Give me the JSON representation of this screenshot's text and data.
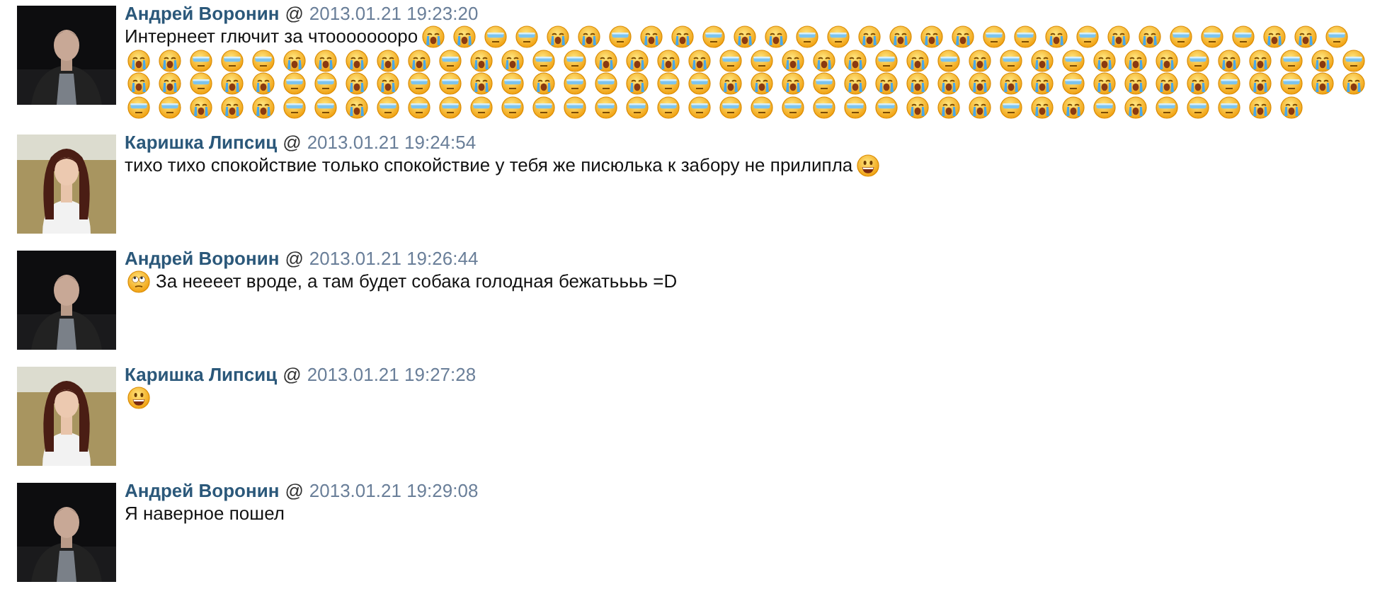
{
  "messages": [
    {
      "author": "Андрей Воронин",
      "at": "@",
      "timestamp": "2013.01.21 19:23:20",
      "avatar": {
        "kind": "night"
      },
      "parts": [
        {
          "kind": "text",
          "text": "Интернеет глючит за чтоооооооро"
        },
        {
          "kind": "sob"
        },
        {
          "kind": "sob"
        },
        {
          "kind": "shades"
        },
        {
          "kind": "shades"
        },
        {
          "kind": "sob"
        },
        {
          "kind": "sob"
        },
        {
          "kind": "shades"
        },
        {
          "kind": "sob"
        },
        {
          "kind": "sob"
        },
        {
          "kind": "shades"
        },
        {
          "kind": "sob"
        },
        {
          "kind": "sob"
        },
        {
          "kind": "shades"
        },
        {
          "kind": "shades"
        },
        {
          "kind": "sob"
        },
        {
          "kind": "sob"
        },
        {
          "kind": "sob"
        },
        {
          "kind": "sob"
        },
        {
          "kind": "shades"
        },
        {
          "kind": "shades"
        },
        {
          "kind": "sob"
        },
        {
          "kind": "shades"
        },
        {
          "kind": "sob"
        },
        {
          "kind": "sob"
        },
        {
          "kind": "shades"
        },
        {
          "kind": "shades"
        },
        {
          "kind": "shades"
        },
        {
          "kind": "sob"
        },
        {
          "kind": "sob"
        },
        {
          "kind": "shades"
        },
        {
          "kind": "sob"
        },
        {
          "kind": "sob"
        },
        {
          "kind": "shades"
        },
        {
          "kind": "shades"
        },
        {
          "kind": "shades"
        },
        {
          "kind": "sob"
        },
        {
          "kind": "sob"
        },
        {
          "kind": "sob"
        },
        {
          "kind": "sob"
        },
        {
          "kind": "sob"
        },
        {
          "kind": "shades"
        },
        {
          "kind": "sob"
        },
        {
          "kind": "sob"
        },
        {
          "kind": "shades"
        },
        {
          "kind": "shades"
        },
        {
          "kind": "sob"
        },
        {
          "kind": "sob"
        },
        {
          "kind": "sob"
        },
        {
          "kind": "sob"
        },
        {
          "kind": "shades"
        },
        {
          "kind": "shades"
        },
        {
          "kind": "sob"
        },
        {
          "kind": "sob"
        },
        {
          "kind": "sob"
        },
        {
          "kind": "shades"
        },
        {
          "kind": "sob"
        },
        {
          "kind": "shades"
        },
        {
          "kind": "sob"
        },
        {
          "kind": "shades"
        },
        {
          "kind": "sob"
        },
        {
          "kind": "shades"
        },
        {
          "kind": "sob"
        },
        {
          "kind": "sob"
        },
        {
          "kind": "sob"
        },
        {
          "kind": "shades"
        },
        {
          "kind": "sob"
        },
        {
          "kind": "sob"
        },
        {
          "kind": "shades"
        },
        {
          "kind": "sob"
        },
        {
          "kind": "shades"
        },
        {
          "kind": "sob"
        },
        {
          "kind": "sob"
        },
        {
          "kind": "shades"
        },
        {
          "kind": "sob"
        },
        {
          "kind": "sob"
        },
        {
          "kind": "shades"
        },
        {
          "kind": "shades"
        },
        {
          "kind": "sob"
        },
        {
          "kind": "sob"
        },
        {
          "kind": "shades"
        },
        {
          "kind": "shades"
        },
        {
          "kind": "sob"
        },
        {
          "kind": "shades"
        },
        {
          "kind": "sob"
        },
        {
          "kind": "shades"
        },
        {
          "kind": "shades"
        },
        {
          "kind": "sob"
        },
        {
          "kind": "shades"
        },
        {
          "kind": "shades"
        },
        {
          "kind": "sob"
        },
        {
          "kind": "sob"
        },
        {
          "kind": "sob"
        },
        {
          "kind": "shades"
        },
        {
          "kind": "sob"
        },
        {
          "kind": "sob"
        },
        {
          "kind": "sob"
        },
        {
          "kind": "sob"
        },
        {
          "kind": "sob"
        },
        {
          "kind": "sob"
        },
        {
          "kind": "sob"
        },
        {
          "kind": "shades"
        },
        {
          "kind": "sob"
        },
        {
          "kind": "sob"
        },
        {
          "kind": "sob"
        },
        {
          "kind": "sob"
        },
        {
          "kind": "shades"
        },
        {
          "kind": "sob"
        },
        {
          "kind": "shades"
        },
        {
          "kind": "sob"
        },
        {
          "kind": "sob"
        },
        {
          "kind": "shades"
        },
        {
          "kind": "shades"
        },
        {
          "kind": "sob"
        },
        {
          "kind": "sob"
        },
        {
          "kind": "sob"
        },
        {
          "kind": "shades"
        },
        {
          "kind": "shades"
        },
        {
          "kind": "sob"
        },
        {
          "kind": "shades"
        },
        {
          "kind": "shades"
        },
        {
          "kind": "shades"
        },
        {
          "kind": "shades"
        },
        {
          "kind": "shades"
        },
        {
          "kind": "shades"
        },
        {
          "kind": "shades"
        },
        {
          "kind": "shades"
        },
        {
          "kind": "shades"
        },
        {
          "kind": "shades"
        },
        {
          "kind": "shades"
        },
        {
          "kind": "shades"
        },
        {
          "kind": "shades"
        },
        {
          "kind": "shades"
        },
        {
          "kind": "shades"
        },
        {
          "kind": "shades"
        },
        {
          "kind": "shades"
        },
        {
          "kind": "sob"
        },
        {
          "kind": "sob"
        },
        {
          "kind": "sob"
        },
        {
          "kind": "shades"
        },
        {
          "kind": "sob"
        },
        {
          "kind": "sob"
        },
        {
          "kind": "shades"
        },
        {
          "kind": "sob"
        },
        {
          "kind": "shades"
        },
        {
          "kind": "shades"
        },
        {
          "kind": "shades"
        },
        {
          "kind": "sob"
        },
        {
          "kind": "sob"
        }
      ]
    },
    {
      "author": "Каришка Липсиц",
      "at": "@",
      "timestamp": "2013.01.21 19:24:54",
      "avatar": {
        "kind": "field"
      },
      "parts": [
        {
          "kind": "text",
          "text": "тихо тихо спокойствие только спокойствие у тебя же писюлька к забору не прилипла"
        },
        {
          "kind": "grin"
        }
      ]
    },
    {
      "author": "Андрей Воронин",
      "at": "@",
      "timestamp": "2013.01.21 19:26:44",
      "avatar": {
        "kind": "night"
      },
      "parts": [
        {
          "kind": "rolleyes"
        },
        {
          "kind": "text",
          "text": "За неееет вроде, а там будет собака голодная бежатьььь =D"
        }
      ]
    },
    {
      "author": "Каришка Липсиц",
      "at": "@",
      "timestamp": "2013.01.21 19:27:28",
      "avatar": {
        "kind": "field"
      },
      "parts": [
        {
          "kind": "grin"
        }
      ]
    },
    {
      "author": "Андрей Воронин",
      "at": "@",
      "timestamp": "2013.01.21 19:29:08",
      "avatar": {
        "kind": "night"
      },
      "parts": [
        {
          "kind": "text",
          "text": "Я наверное пошел"
        }
      ]
    }
  ]
}
